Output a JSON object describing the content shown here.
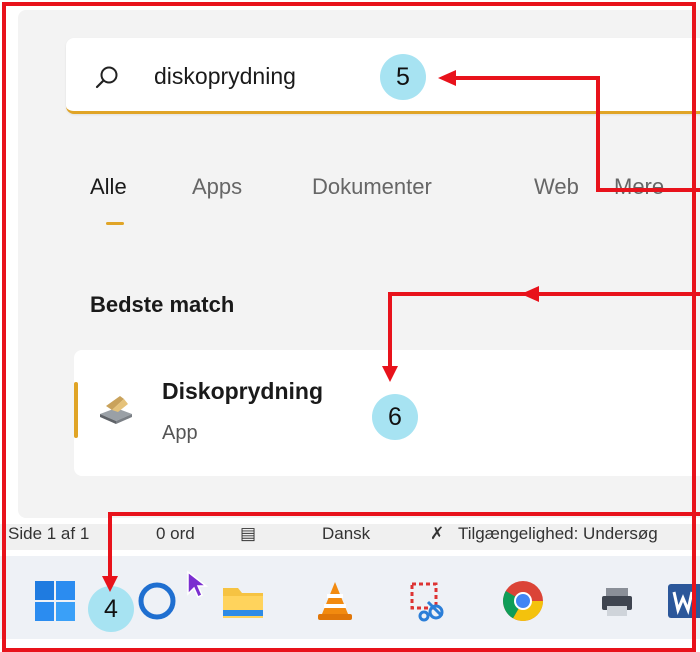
{
  "search": {
    "icon": "search-icon",
    "query": "diskoprydning"
  },
  "tabs": [
    {
      "label": "Alle",
      "active": true
    },
    {
      "label": "Apps",
      "active": false
    },
    {
      "label": "Dokumenter",
      "active": false
    },
    {
      "label": "Web",
      "active": false
    },
    {
      "label": "Mere",
      "active": false
    }
  ],
  "section": {
    "title": "Bedste match"
  },
  "result": {
    "title": "Diskoprydning",
    "subtitle": "App",
    "icon": "disk-cleanup-icon"
  },
  "statusbar": {
    "page": "Side 1 af 1",
    "words": "0 ord",
    "language": "Dansk",
    "accessibility": "Tilgængelighed: Undersøg"
  },
  "taskbar": {
    "items": [
      "start-icon",
      "cortana-icon",
      "file-explorer-icon",
      "vlc-icon",
      "snipping-tool-icon",
      "chrome-icon",
      "printer-icon",
      "word-icon"
    ]
  },
  "annotations": {
    "step_search": "5",
    "step_result": "6",
    "step_start": "4"
  },
  "colors": {
    "accent": "#e0a426",
    "annotation_red": "#e8121b",
    "badge": "#a7e3f2"
  }
}
